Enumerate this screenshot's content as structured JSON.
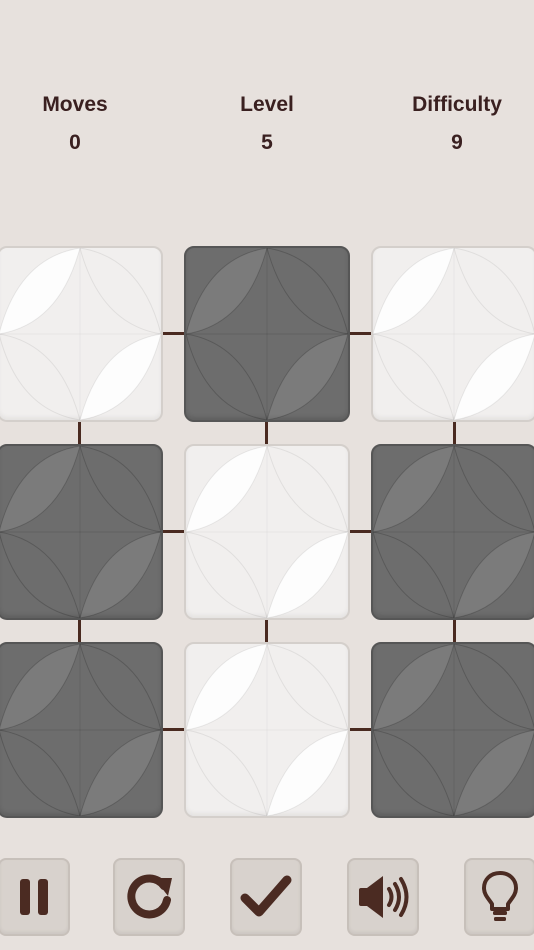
{
  "stats": {
    "moves": {
      "label": "Moves",
      "value": "0"
    },
    "level": {
      "label": "Level",
      "value": "5"
    },
    "difficulty": {
      "label": "Difficulty",
      "value": "9"
    }
  },
  "board": {
    "rows": 3,
    "cols": 3,
    "tiles": [
      [
        "light",
        "dark",
        "light"
      ],
      [
        "dark",
        "light",
        "dark"
      ],
      [
        "dark",
        "light",
        "dark"
      ]
    ]
  },
  "toolbar": {
    "buttons": [
      "pause-icon",
      "restart-icon",
      "check-icon",
      "sound-icon",
      "hint-icon"
    ]
  },
  "colors": {
    "background": "#e7e1dd",
    "light_tile": "#f1efee",
    "dark_tile": "#6d6d6d",
    "connector": "#4a2a20",
    "text": "#3a2020",
    "icon": "#4b2b22"
  }
}
